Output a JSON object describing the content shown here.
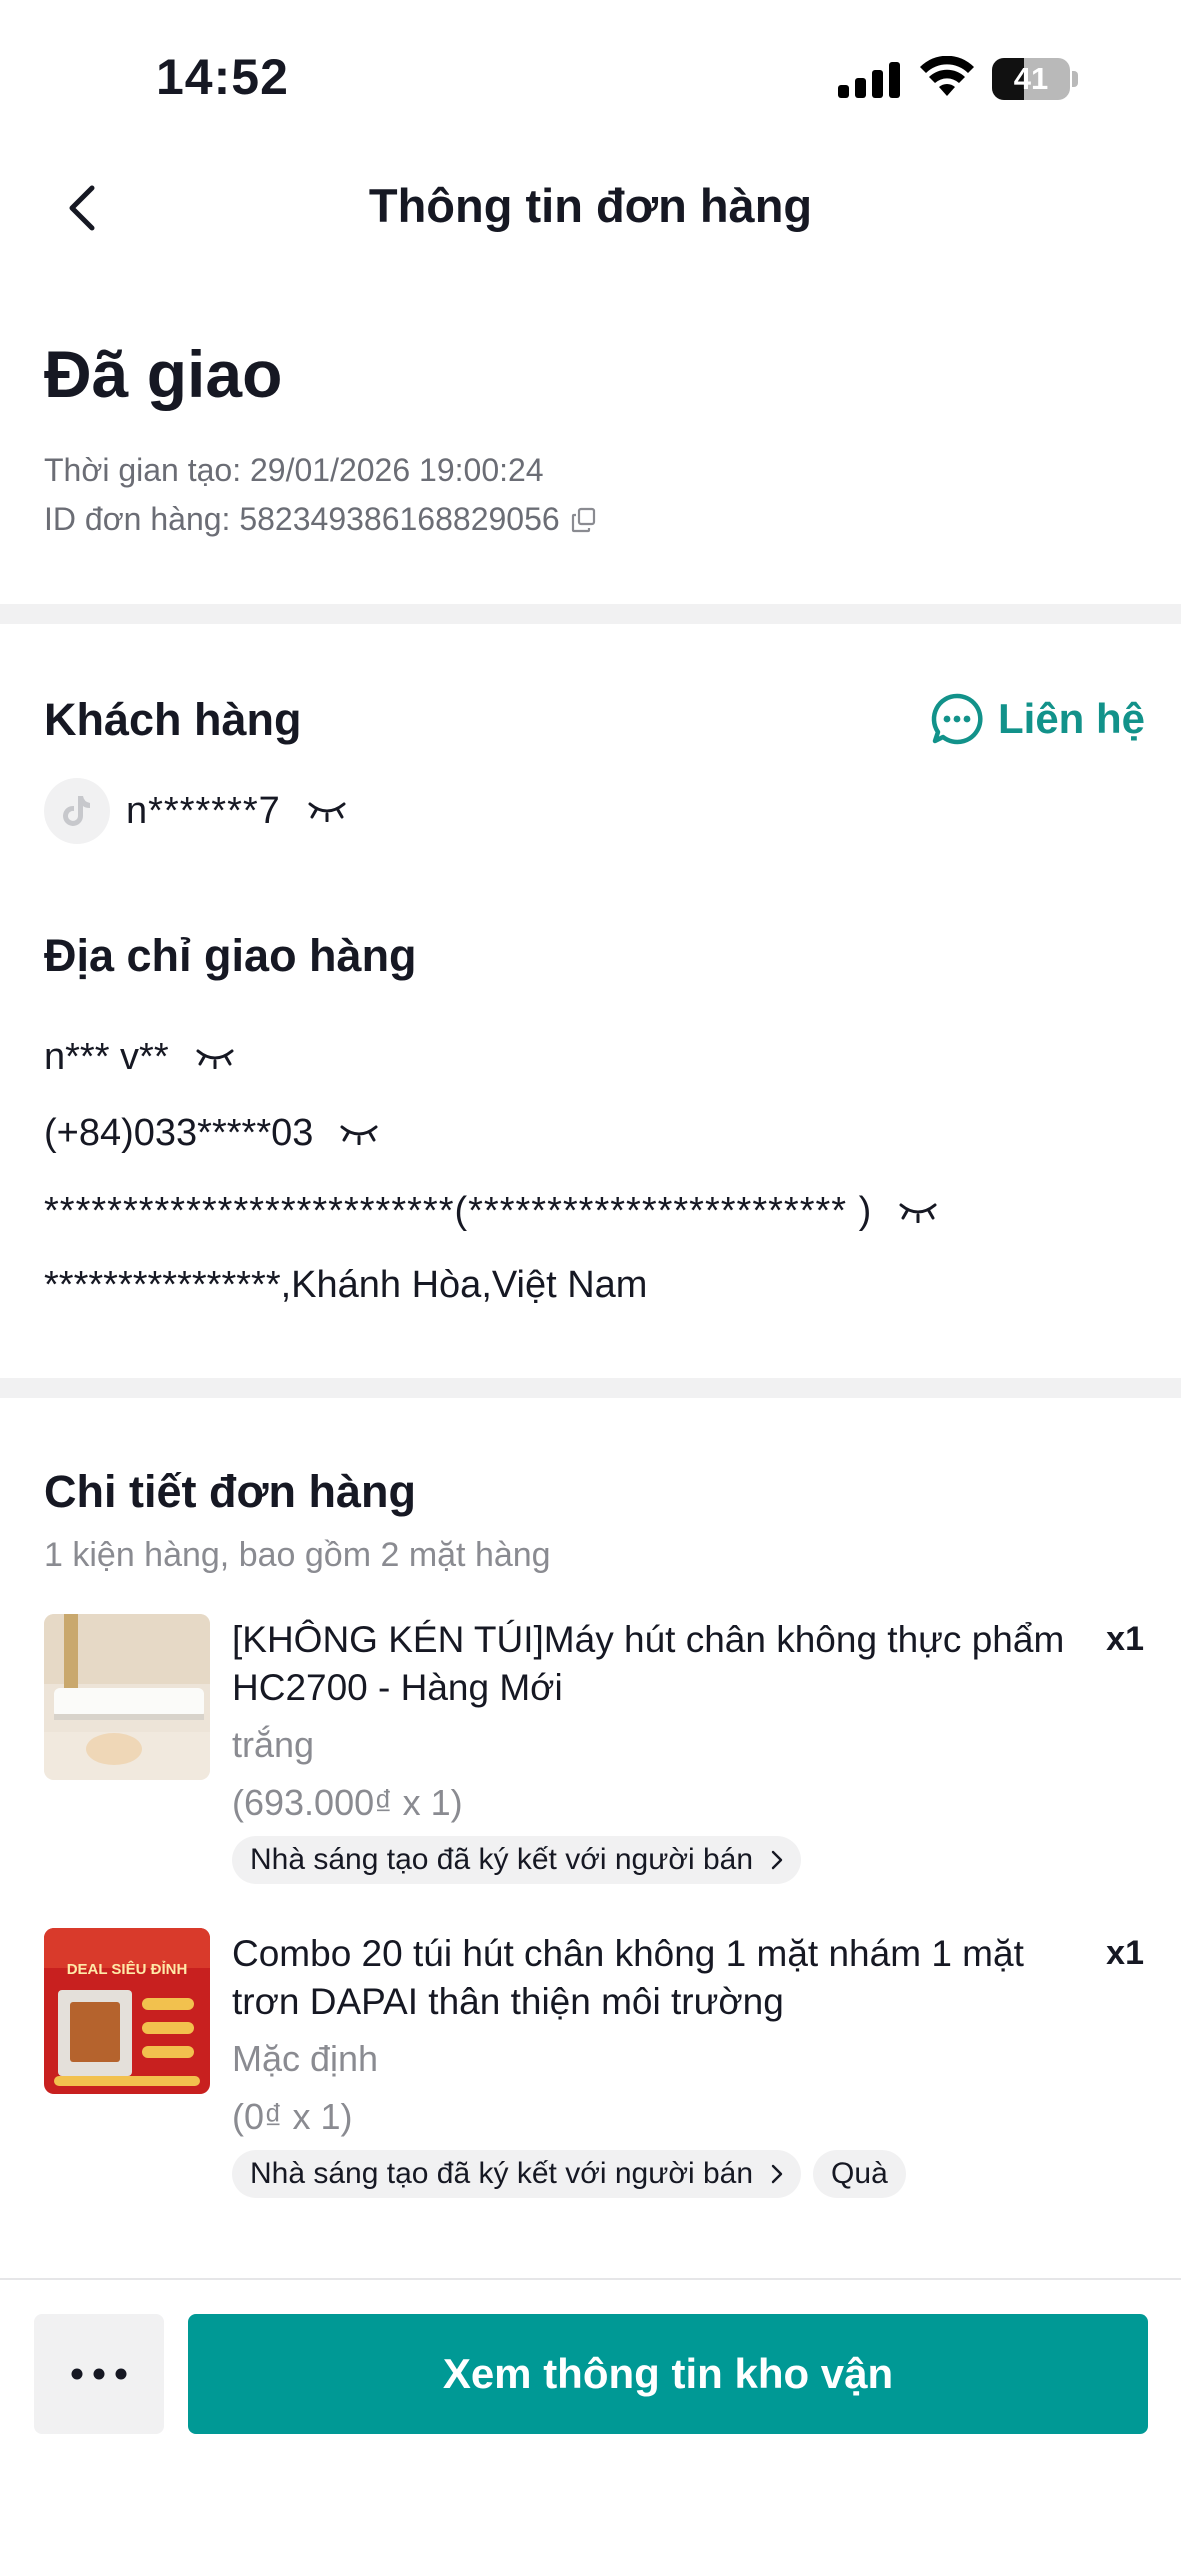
{
  "status_bar": {
    "time": "14:52",
    "battery": "41",
    "battery_level": 0.41
  },
  "nav": {
    "title": "Thông tin đơn hàng"
  },
  "order": {
    "status": "Đã giao",
    "created": "Thời gian tạo: 29/01/2026 19:00:24",
    "order_id": "ID đơn hàng: 582349386168829056"
  },
  "customer": {
    "title": "Khách hàng",
    "contact_label": "Liên hệ",
    "name": "n*******7"
  },
  "address": {
    "title": "Địa chỉ giao hàng",
    "name": "n*** v**",
    "phone": "(+84)033*****03",
    "street": "**************************(************************ )",
    "region": "****************,Khánh Hòa,Việt Nam"
  },
  "details": {
    "title": "Chi tiết đơn hàng",
    "subtitle": "1 kiện hàng, bao gồm 2 mặt hàng",
    "items": [
      {
        "name": "[KHÔNG KÉN TÚI]Máy hút chân không thực phẩm HC2700 - Hàng Mới",
        "variant": "trắng",
        "price": "(693.000₫ x 1)",
        "qty": "x1",
        "tag": "Nhà sáng tạo đã ký kết với người bán"
      },
      {
        "name": "Combo 20 túi hút chân không 1 mặt nhám 1 mặt trơn DAPAI thân thiện môi trường",
        "variant": "Mặc định",
        "price": "(0₫ x 1)",
        "qty": "x1",
        "tag": "Nhà sáng tạo đã ký kết với người bán",
        "gift_tag": "Quà",
        "thumb_text": "DEAL SIÊU ĐỈNH"
      }
    ]
  },
  "actions": {
    "primary_label": "Xem thông tin kho vận"
  },
  "colors": {
    "accent": "#009995",
    "link": "#12928a",
    "divider": "#f1f1f2"
  }
}
